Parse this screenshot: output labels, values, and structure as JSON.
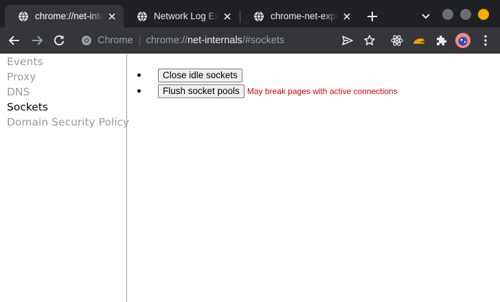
{
  "tabs": [
    {
      "title": "chrome://net-internals/#sockets",
      "active": true
    },
    {
      "title": "Network Log Export",
      "active": false
    },
    {
      "title": "chrome-net-export-log.json",
      "active": false
    }
  ],
  "toolbar": {
    "chip_label": "Chrome",
    "url_scheme": "chrome://",
    "url_host": "net-internals",
    "url_path": "/#sockets"
  },
  "sidebar": {
    "items": [
      {
        "label": "Events",
        "selected": false
      },
      {
        "label": "Proxy",
        "selected": false
      },
      {
        "label": "DNS",
        "selected": false
      },
      {
        "label": "Sockets",
        "selected": true
      },
      {
        "label": "Domain Security Policy",
        "selected": false
      }
    ]
  },
  "sockets": {
    "close_idle_label": "Close idle sockets",
    "flush_pools_label": "Flush socket pools",
    "flush_warning": "May break pages with active connections"
  },
  "colors": {
    "tabstrip_bg": "#202124",
    "toolbar_bg": "#35363a",
    "warning_red": "#cc0000",
    "window_button_max": "#f9ab00"
  },
  "icons": [
    "globe-icon",
    "close-icon",
    "plus-icon",
    "chevron-down-icon",
    "back-arrow-icon",
    "forward-arrow-icon",
    "reload-icon",
    "chrome-icon",
    "send-icon",
    "star-icon",
    "react-icon",
    "extension-icon",
    "puzzle-icon",
    "more-vert-icon"
  ]
}
